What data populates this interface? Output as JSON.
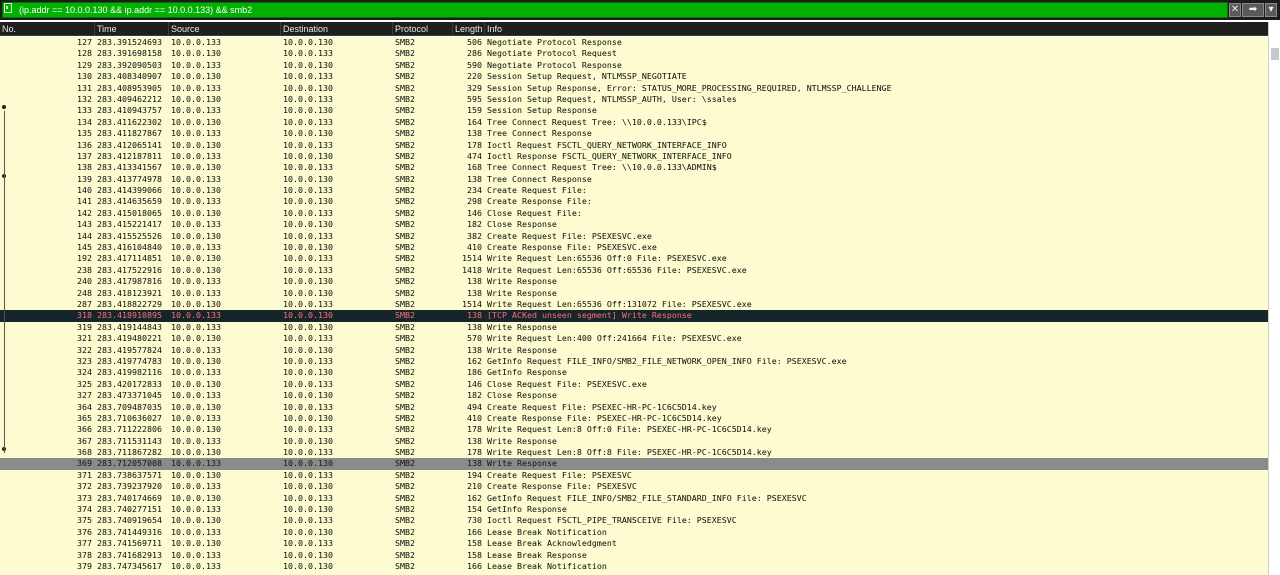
{
  "filter": {
    "value": "(ip.addr == 10.0.0.130 && ip.addr == 10.0.0.133) && smb2",
    "clear_label": "✕",
    "apply_label": "➡",
    "dropdown_label": "▾"
  },
  "columns": {
    "no": "No.",
    "time": "Time",
    "source": "Source",
    "destination": "Destination",
    "protocol": "Protocol",
    "length": "Length",
    "info": "Info"
  },
  "colors": {
    "filter_bg": "#00b100",
    "row_bg": "#fdfcd0",
    "selected_dark_bg": "#16242c",
    "selected_dark_text": "#ff7070",
    "selected_grey_bg": "#8a8a8a"
  },
  "packets": [
    {
      "no": "127",
      "time": "283.391524693",
      "src": "10.0.0.133",
      "dst": "10.0.0.130",
      "proto": "SMB2",
      "len": "506",
      "info": "Negotiate Protocol Response"
    },
    {
      "no": "128",
      "time": "283.391698158",
      "src": "10.0.0.130",
      "dst": "10.0.0.133",
      "proto": "SMB2",
      "len": "286",
      "info": "Negotiate Protocol Request"
    },
    {
      "no": "129",
      "time": "283.392090503",
      "src": "10.0.0.133",
      "dst": "10.0.0.130",
      "proto": "SMB2",
      "len": "590",
      "info": "Negotiate Protocol Response"
    },
    {
      "no": "130",
      "time": "283.408340907",
      "src": "10.0.0.130",
      "dst": "10.0.0.133",
      "proto": "SMB2",
      "len": "220",
      "info": "Session Setup Request, NTLMSSP_NEGOTIATE"
    },
    {
      "no": "131",
      "time": "283.408953905",
      "src": "10.0.0.133",
      "dst": "10.0.0.130",
      "proto": "SMB2",
      "len": "329",
      "info": "Session Setup Response, Error: STATUS_MORE_PROCESSING_REQUIRED, NTLMSSP_CHALLENGE"
    },
    {
      "no": "132",
      "time": "283.409462212",
      "src": "10.0.0.130",
      "dst": "10.0.0.133",
      "proto": "SMB2",
      "len": "595",
      "info": "Session Setup Request, NTLMSSP_AUTH, User: \\ssales"
    },
    {
      "no": "133",
      "time": "283.410943757",
      "src": "10.0.0.133",
      "dst": "10.0.0.130",
      "proto": "SMB2",
      "len": "159",
      "info": "Session Setup Response"
    },
    {
      "no": "134",
      "time": "283.411622302",
      "src": "10.0.0.130",
      "dst": "10.0.0.133",
      "proto": "SMB2",
      "len": "164",
      "info": "Tree Connect Request Tree: \\\\10.0.0.133\\IPC$"
    },
    {
      "no": "135",
      "time": "283.411827867",
      "src": "10.0.0.133",
      "dst": "10.0.0.130",
      "proto": "SMB2",
      "len": "138",
      "info": "Tree Connect Response"
    },
    {
      "no": "136",
      "time": "283.412065141",
      "src": "10.0.0.130",
      "dst": "10.0.0.133",
      "proto": "SMB2",
      "len": "178",
      "info": "Ioctl Request FSCTL_QUERY_NETWORK_INTERFACE_INFO"
    },
    {
      "no": "137",
      "time": "283.412187811",
      "src": "10.0.0.133",
      "dst": "10.0.0.130",
      "proto": "SMB2",
      "len": "474",
      "info": "Ioctl Response FSCTL_QUERY_NETWORK_INTERFACE_INFO"
    },
    {
      "no": "138",
      "time": "283.413341567",
      "src": "10.0.0.130",
      "dst": "10.0.0.133",
      "proto": "SMB2",
      "len": "168",
      "info": "Tree Connect Request Tree: \\\\10.0.0.133\\ADMIN$"
    },
    {
      "no": "139",
      "time": "283.413774978",
      "src": "10.0.0.133",
      "dst": "10.0.0.130",
      "proto": "SMB2",
      "len": "138",
      "info": "Tree Connect Response"
    },
    {
      "no": "140",
      "time": "283.414399066",
      "src": "10.0.0.130",
      "dst": "10.0.0.133",
      "proto": "SMB2",
      "len": "234",
      "info": "Create Request File:"
    },
    {
      "no": "141",
      "time": "283.414635659",
      "src": "10.0.0.133",
      "dst": "10.0.0.130",
      "proto": "SMB2",
      "len": "298",
      "info": "Create Response File:"
    },
    {
      "no": "142",
      "time": "283.415018065",
      "src": "10.0.0.130",
      "dst": "10.0.0.133",
      "proto": "SMB2",
      "len": "146",
      "info": "Close Request File:"
    },
    {
      "no": "143",
      "time": "283.415221417",
      "src": "10.0.0.133",
      "dst": "10.0.0.130",
      "proto": "SMB2",
      "len": "182",
      "info": "Close Response"
    },
    {
      "no": "144",
      "time": "283.415525526",
      "src": "10.0.0.130",
      "dst": "10.0.0.133",
      "proto": "SMB2",
      "len": "382",
      "info": "Create Request File: PSEXESVC.exe"
    },
    {
      "no": "145",
      "time": "283.416104840",
      "src": "10.0.0.133",
      "dst": "10.0.0.130",
      "proto": "SMB2",
      "len": "410",
      "info": "Create Response File: PSEXESVC.exe"
    },
    {
      "no": "192",
      "time": "283.417114851",
      "src": "10.0.0.130",
      "dst": "10.0.0.133",
      "proto": "SMB2",
      "len": "1514",
      "info": "Write Request Len:65536 Off:0 File: PSEXESVC.exe"
    },
    {
      "no": "238",
      "time": "283.417522916",
      "src": "10.0.0.130",
      "dst": "10.0.0.133",
      "proto": "SMB2",
      "len": "1418",
      "info": "Write Request Len:65536 Off:65536 File: PSEXESVC.exe"
    },
    {
      "no": "240",
      "time": "283.417987816",
      "src": "10.0.0.133",
      "dst": "10.0.0.130",
      "proto": "SMB2",
      "len": "138",
      "info": "Write Response"
    },
    {
      "no": "248",
      "time": "283.418123921",
      "src": "10.0.0.133",
      "dst": "10.0.0.130",
      "proto": "SMB2",
      "len": "138",
      "info": "Write Response"
    },
    {
      "no": "287",
      "time": "283.418822729",
      "src": "10.0.0.130",
      "dst": "10.0.0.133",
      "proto": "SMB2",
      "len": "1514",
      "info": "Write Request Len:65536 Off:131072 File: PSEXESVC.exe"
    },
    {
      "no": "318",
      "time": "283.418910895",
      "src": "10.0.0.133",
      "dst": "10.0.0.130",
      "proto": "SMB2",
      "len": "138",
      "info": "[TCP ACKed unseen segment] Write Response",
      "style": "sel-dark"
    },
    {
      "no": "319",
      "time": "283.419144843",
      "src": "10.0.0.133",
      "dst": "10.0.0.130",
      "proto": "SMB2",
      "len": "138",
      "info": "Write Response"
    },
    {
      "no": "321",
      "time": "283.419480221",
      "src": "10.0.0.130",
      "dst": "10.0.0.133",
      "proto": "SMB2",
      "len": "570",
      "info": "Write Request Len:400 Off:241664 File: PSEXESVC.exe"
    },
    {
      "no": "322",
      "time": "283.419577824",
      "src": "10.0.0.133",
      "dst": "10.0.0.130",
      "proto": "SMB2",
      "len": "138",
      "info": "Write Response"
    },
    {
      "no": "323",
      "time": "283.419774783",
      "src": "10.0.0.130",
      "dst": "10.0.0.133",
      "proto": "SMB2",
      "len": "162",
      "info": "GetInfo Request FILE_INFO/SMB2_FILE_NETWORK_OPEN_INFO File: PSEXESVC.exe"
    },
    {
      "no": "324",
      "time": "283.419982116",
      "src": "10.0.0.133",
      "dst": "10.0.0.130",
      "proto": "SMB2",
      "len": "186",
      "info": "GetInfo Response"
    },
    {
      "no": "325",
      "time": "283.420172833",
      "src": "10.0.0.130",
      "dst": "10.0.0.133",
      "proto": "SMB2",
      "len": "146",
      "info": "Close Request File: PSEXESVC.exe"
    },
    {
      "no": "327",
      "time": "283.473371045",
      "src": "10.0.0.133",
      "dst": "10.0.0.130",
      "proto": "SMB2",
      "len": "182",
      "info": "Close Response"
    },
    {
      "no": "364",
      "time": "283.709487035",
      "src": "10.0.0.130",
      "dst": "10.0.0.133",
      "proto": "SMB2",
      "len": "494",
      "info": "Create Request File: PSEXEC-HR-PC-1C6C5D14.key"
    },
    {
      "no": "365",
      "time": "283.710636027",
      "src": "10.0.0.133",
      "dst": "10.0.0.130",
      "proto": "SMB2",
      "len": "410",
      "info": "Create Response File: PSEXEC-HR-PC-1C6C5D14.key"
    },
    {
      "no": "366",
      "time": "283.711222806",
      "src": "10.0.0.130",
      "dst": "10.0.0.133",
      "proto": "SMB2",
      "len": "178",
      "info": "Write Request Len:8 Off:0 File: PSEXEC-HR-PC-1C6C5D14.key"
    },
    {
      "no": "367",
      "time": "283.711531143",
      "src": "10.0.0.133",
      "dst": "10.0.0.130",
      "proto": "SMB2",
      "len": "138",
      "info": "Write Response"
    },
    {
      "no": "368",
      "time": "283.711867282",
      "src": "10.0.0.130",
      "dst": "10.0.0.133",
      "proto": "SMB2",
      "len": "178",
      "info": "Write Request Len:8 Off:8 File: PSEXEC-HR-PC-1C6C5D14.key"
    },
    {
      "no": "369",
      "time": "283.712057008",
      "src": "10.0.0.133",
      "dst": "10.0.0.130",
      "proto": "SMB2",
      "len": "138",
      "info": "Write Response",
      "style": "sel-grey"
    },
    {
      "no": "371",
      "time": "283.738637571",
      "src": "10.0.0.130",
      "dst": "10.0.0.133",
      "proto": "SMB2",
      "len": "194",
      "info": "Create Request File: PSEXESVC"
    },
    {
      "no": "372",
      "time": "283.739237920",
      "src": "10.0.0.133",
      "dst": "10.0.0.130",
      "proto": "SMB2",
      "len": "210",
      "info": "Create Response File: PSEXESVC"
    },
    {
      "no": "373",
      "time": "283.740174669",
      "src": "10.0.0.130",
      "dst": "10.0.0.133",
      "proto": "SMB2",
      "len": "162",
      "info": "GetInfo Request FILE_INFO/SMB2_FILE_STANDARD_INFO File: PSEXESVC"
    },
    {
      "no": "374",
      "time": "283.740277151",
      "src": "10.0.0.133",
      "dst": "10.0.0.130",
      "proto": "SMB2",
      "len": "154",
      "info": "GetInfo Response"
    },
    {
      "no": "375",
      "time": "283.740919654",
      "src": "10.0.0.130",
      "dst": "10.0.0.133",
      "proto": "SMB2",
      "len": "730",
      "info": "Ioctl Request FSCTL_PIPE_TRANSCEIVE File: PSEXESVC"
    },
    {
      "no": "376",
      "time": "283.741449316",
      "src": "10.0.0.133",
      "dst": "10.0.0.130",
      "proto": "SMB2",
      "len": "166",
      "info": "Lease Break Notification"
    },
    {
      "no": "377",
      "time": "283.741569711",
      "src": "10.0.0.130",
      "dst": "10.0.0.133",
      "proto": "SMB2",
      "len": "158",
      "info": "Lease Break Acknowledgment"
    },
    {
      "no": "378",
      "time": "283.741682913",
      "src": "10.0.0.133",
      "dst": "10.0.0.130",
      "proto": "SMB2",
      "len": "158",
      "info": "Lease Break Response"
    },
    {
      "no": "379",
      "time": "283.747345617",
      "src": "10.0.0.133",
      "dst": "10.0.0.130",
      "proto": "SMB2",
      "len": "166",
      "info": "Lease Break Notification"
    }
  ]
}
